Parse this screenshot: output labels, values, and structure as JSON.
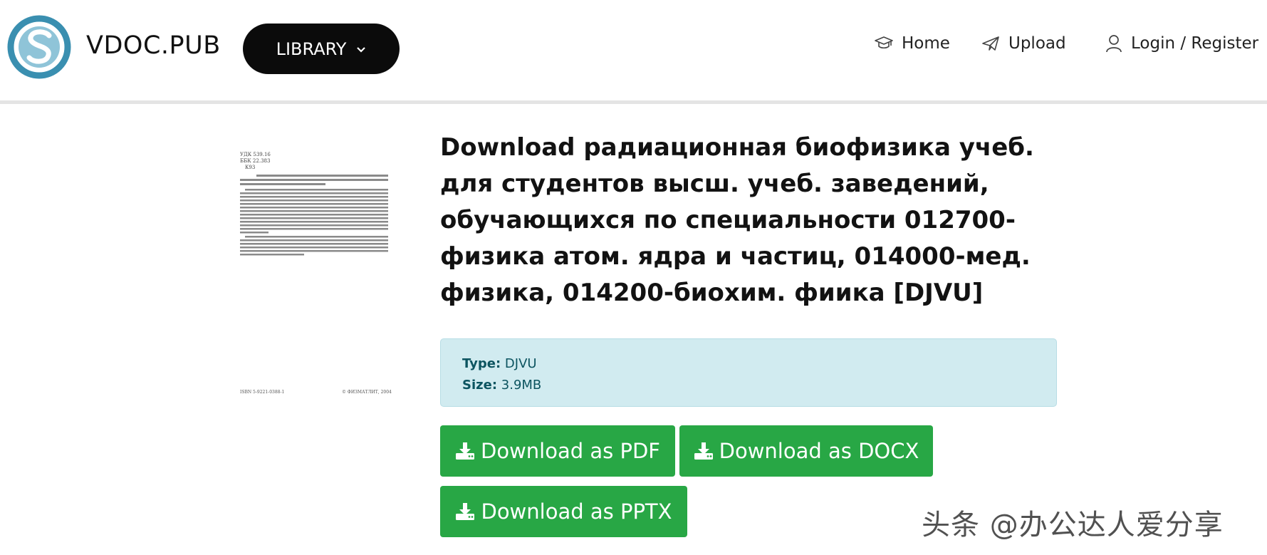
{
  "header": {
    "logo_text": "VDOC.PUB",
    "library_label": "LIBRARY",
    "nav": {
      "home": "Home",
      "upload": "Upload",
      "login": "Login / Register"
    }
  },
  "main": {
    "title": "Download радиационная биофизика учеб. для студентов высш. учеб. заведений, обучающихся по специальности 012700-физика атом. ядра и частиц, 014000-мед. физика, 014200-биохим. фиика [DJVU]",
    "info": {
      "type_label": "Type:",
      "type_value": "DJVU",
      "size_label": "Size:",
      "size_value": "3.9MB"
    },
    "buttons": {
      "pdf": "Download as PDF",
      "docx": "Download as DOCX",
      "pptx": "Download as PPTX"
    }
  },
  "cover": {
    "top_lines": [
      "УДК 539.16",
      "ББК 22.383",
      "К93"
    ],
    "footer_left": "ISBN 5-9221-0388-1",
    "footer_right": "© ФИЗМАТЛИТ, 2004"
  },
  "watermark": "头条 @办公达人爱分享",
  "colors": {
    "accent_green": "#28a745",
    "info_bg": "#d1ebf0",
    "library_bg": "#0b0b0b",
    "logo_blue": "#3a8fb0"
  },
  "icons": {
    "logo": "vdoc-logo-icon",
    "chevron": "chevron-down-icon",
    "home": "graduation-cap-icon",
    "upload": "paper-plane-icon",
    "login": "user-icon",
    "download": "download-icon"
  }
}
